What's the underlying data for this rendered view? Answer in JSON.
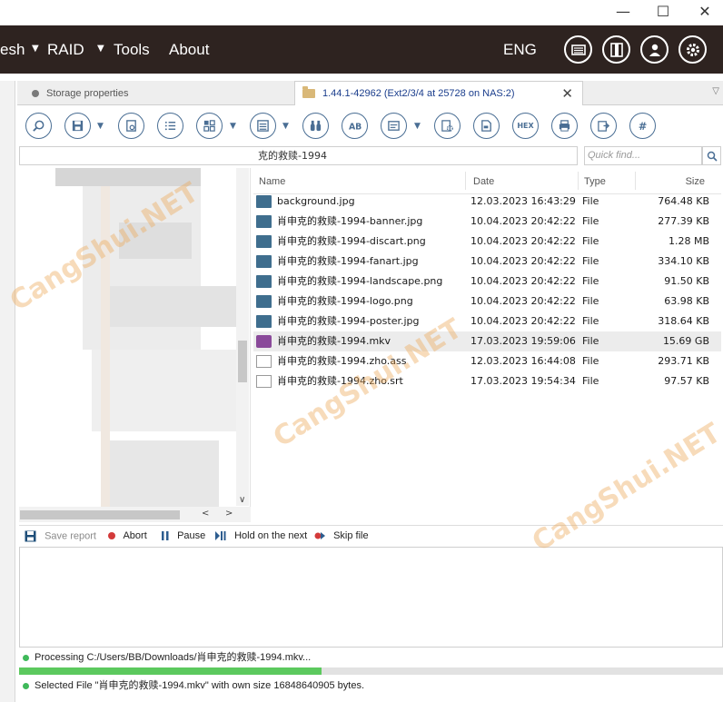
{
  "window": {
    "minimize": "—",
    "maximize": "☐",
    "close": "✕"
  },
  "menu": {
    "items": [
      {
        "label": "esh"
      },
      {
        "label": "RAID"
      },
      {
        "label": "Tools"
      },
      {
        "label": "About"
      }
    ],
    "language": "ENG",
    "icons": [
      "drive-icon",
      "panel-icon",
      "user-icon",
      "gear-icon"
    ]
  },
  "tabs": {
    "inactive_label": "Storage properties",
    "active_label": "1.44.1-42962 (Ext2/3/4 at 25728 on NAS:2)"
  },
  "toolbar": {
    "buttons": [
      "find-icon",
      "save-icon",
      "scan-icon",
      "list-icon",
      "view-icon",
      "details-icon",
      "binoculars-icon",
      "ab-icon",
      "preview-icon",
      "settings-icon",
      "doc-icon",
      "hex-icon",
      "print-icon",
      "export-icon",
      "hash-icon"
    ],
    "hex_label": "HEX"
  },
  "path": {
    "value": "克的救赎-1994"
  },
  "search": {
    "placeholder": "Quick find..."
  },
  "columns": {
    "name": "Name",
    "date": "Date",
    "type": "Type",
    "size": "Size"
  },
  "files": [
    {
      "name": "background.jpg",
      "date": "12.03.2023 16:43:29",
      "type": "File",
      "size": "764.48 KB",
      "kind": "image"
    },
    {
      "name": "肖申克的救赎-1994-banner.jpg",
      "date": "10.04.2023 20:42:22",
      "type": "File",
      "size": "277.39 KB",
      "kind": "image"
    },
    {
      "name": "肖申克的救赎-1994-discart.png",
      "date": "10.04.2023 20:42:22",
      "type": "File",
      "size": "1.28 MB",
      "kind": "image"
    },
    {
      "name": "肖申克的救赎-1994-fanart.jpg",
      "date": "10.04.2023 20:42:22",
      "type": "File",
      "size": "334.10 KB",
      "kind": "image"
    },
    {
      "name": "肖申克的救赎-1994-landscape.png",
      "date": "10.04.2023 20:42:22",
      "type": "File",
      "size": "91.50 KB",
      "kind": "image"
    },
    {
      "name": "肖申克的救赎-1994-logo.png",
      "date": "10.04.2023 20:42:22",
      "type": "File",
      "size": "63.98 KB",
      "kind": "image"
    },
    {
      "name": "肖申克的救赎-1994-poster.jpg",
      "date": "10.04.2023 20:42:22",
      "type": "File",
      "size": "318.64 KB",
      "kind": "image"
    },
    {
      "name": "肖申克的救赎-1994.mkv",
      "date": "17.03.2023 19:59:06",
      "type": "File",
      "size": "15.69 GB",
      "kind": "video"
    },
    {
      "name": "肖申克的救赎-1994.zho.ass",
      "date": "12.03.2023 16:44:08",
      "type": "File",
      "size": "293.71 KB",
      "kind": "text"
    },
    {
      "name": "肖申克的救赎-1994.zho.srt",
      "date": "17.03.2023 19:54:34",
      "type": "File",
      "size": "97.57 KB",
      "kind": "text"
    }
  ],
  "report_toolbar": {
    "save_report": "Save report",
    "abort": "Abort",
    "pause": "Pause",
    "hold": "Hold on the next",
    "skip": "Skip file"
  },
  "status": {
    "processing": "Processing C:/Users/BB/Downloads/肖申克的救赎-1994.mkv...",
    "progress_fraction": 0.43,
    "selected": "Selected File \"肖申克的救赎-1994.mkv\" with own size 16848640905 bytes."
  },
  "watermark": "CangShui.NET",
  "colors": {
    "menubar": "#2e2320",
    "accent": "#4a6e94",
    "progress": "#5cc95e",
    "status_dot": "#3fb95a",
    "abort_dot": "#d33a3a"
  }
}
